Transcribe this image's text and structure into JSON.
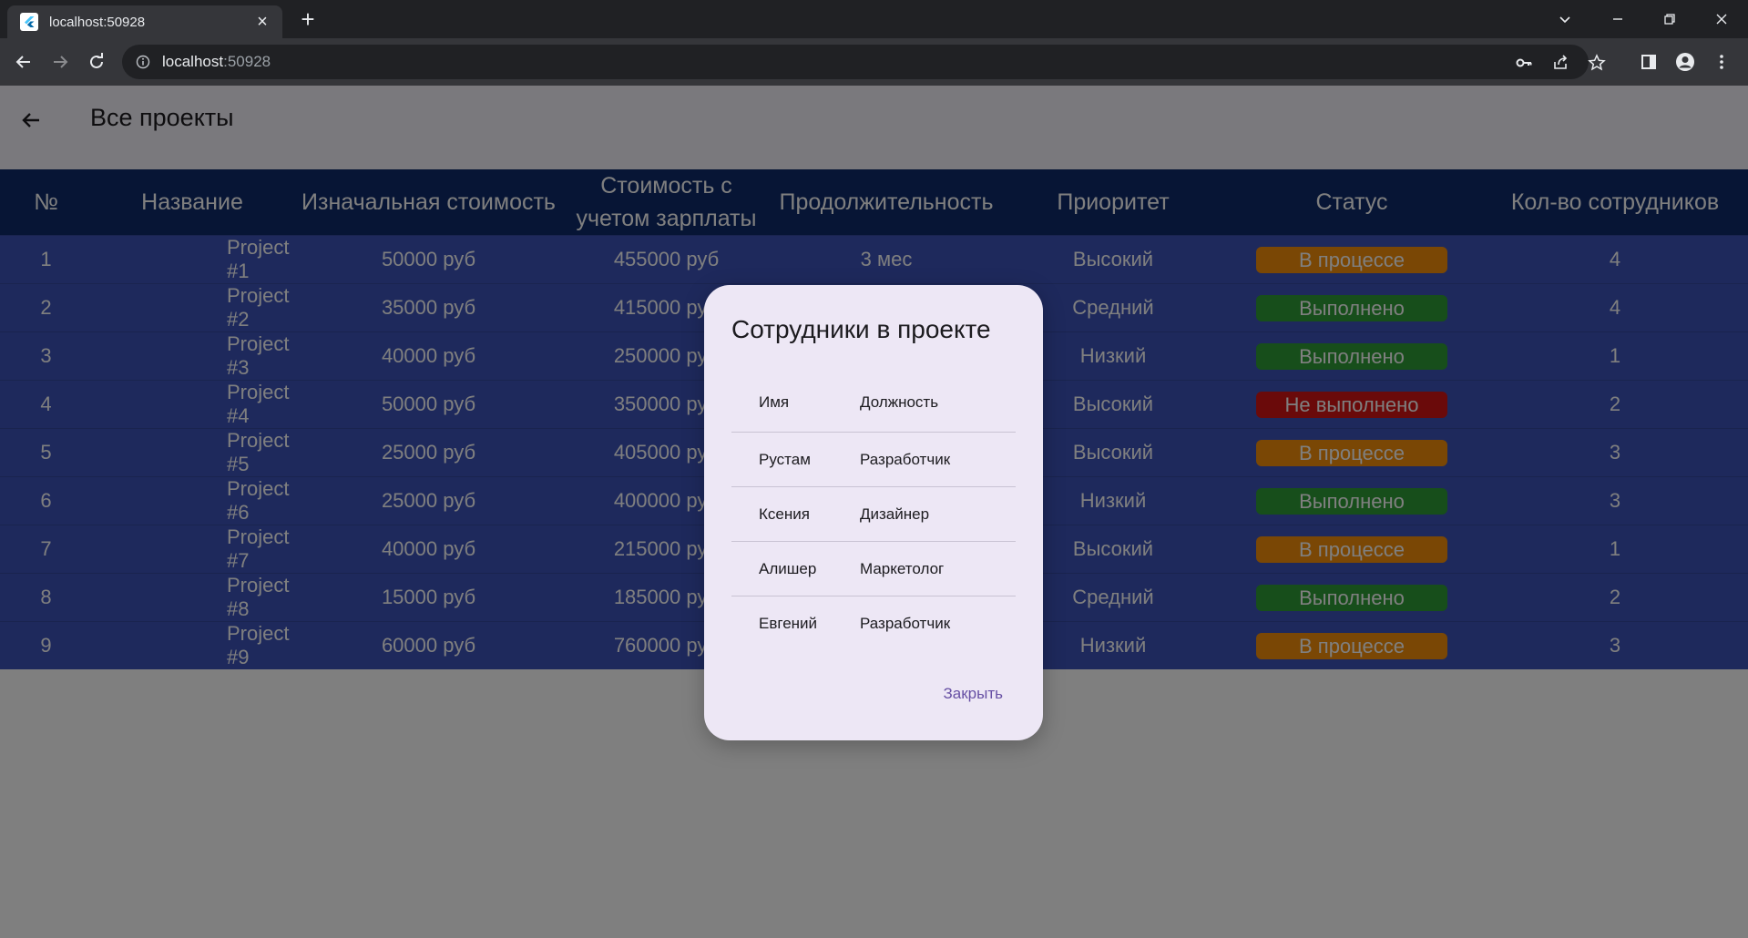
{
  "browser": {
    "tab_title": "localhost:50928",
    "url_host": "localhost",
    "url_port": ":50928"
  },
  "app": {
    "page_title": "Все проекты"
  },
  "table": {
    "headers": [
      "№",
      "Название",
      "Изначальная стоимость",
      "Стоимость с учетом зарплаты",
      "Продолжительность",
      "Приоритет",
      "Статус",
      "Кол-во сотрудников"
    ],
    "rows": [
      {
        "num": "1",
        "name": "Project #1",
        "initial": "50000 руб",
        "total": "455000 руб",
        "duration": "3 мес",
        "priority": "Высокий",
        "status": "В процессе",
        "status_color": "#f58f0a",
        "count": "4"
      },
      {
        "num": "2",
        "name": "Project #2",
        "initial": "35000 руб",
        "total": "415000 руб",
        "duration": "",
        "priority": "Средний",
        "status": "Выполнено",
        "status_color": "#2e9c37",
        "count": "4"
      },
      {
        "num": "3",
        "name": "Project #3",
        "initial": "40000 руб",
        "total": "250000 руб",
        "duration": "",
        "priority": "Низкий",
        "status": "Выполнено",
        "status_color": "#2e9c37",
        "count": "1"
      },
      {
        "num": "4",
        "name": "Project #4",
        "initial": "50000 руб",
        "total": "350000 руб",
        "duration": "",
        "priority": "Высокий",
        "status": "Не выполнено",
        "status_color": "#d51515",
        "count": "2"
      },
      {
        "num": "5",
        "name": "Project #5",
        "initial": "25000 руб",
        "total": "405000 руб",
        "duration": "",
        "priority": "Высокий",
        "status": "В процессе",
        "status_color": "#f58f0a",
        "count": "3"
      },
      {
        "num": "6",
        "name": "Project #6",
        "initial": "25000 руб",
        "total": "400000 руб",
        "duration": "",
        "priority": "Низкий",
        "status": "Выполнено",
        "status_color": "#2e9c37",
        "count": "3"
      },
      {
        "num": "7",
        "name": "Project #7",
        "initial": "40000 руб",
        "total": "215000 руб",
        "duration": "",
        "priority": "Высокий",
        "status": "В процессе",
        "status_color": "#f58f0a",
        "count": "1"
      },
      {
        "num": "8",
        "name": "Project #8",
        "initial": "15000 руб",
        "total": "185000 руб",
        "duration": "",
        "priority": "Средний",
        "status": "Выполнено",
        "status_color": "#2e9c37",
        "count": "2"
      },
      {
        "num": "9",
        "name": "Project #9",
        "initial": "60000 руб",
        "total": "760000 руб",
        "duration": "",
        "priority": "Низкий",
        "status": "В процессе",
        "status_color": "#f58f0a",
        "count": "3"
      }
    ]
  },
  "dialog": {
    "title": "Сотрудники в проекте",
    "col_name": "Имя",
    "col_role": "Должность",
    "employees": [
      {
        "name": "Рустам",
        "role": "Разработчик"
      },
      {
        "name": "Ксения",
        "role": "Дизайнер"
      },
      {
        "name": "Алишер",
        "role": "Маркетолог"
      },
      {
        "name": "Евгений",
        "role": "Разработчик"
      }
    ],
    "close_label": "Закрыть"
  },
  "colors": {
    "header_bg": "#0f2a6b",
    "row_bg": "#3d52b8",
    "in_progress": "#f58f0a",
    "done": "#2e9c37",
    "not_done": "#d51515",
    "dialog_bg": "#ede7f5",
    "accent": "#6750a4"
  }
}
